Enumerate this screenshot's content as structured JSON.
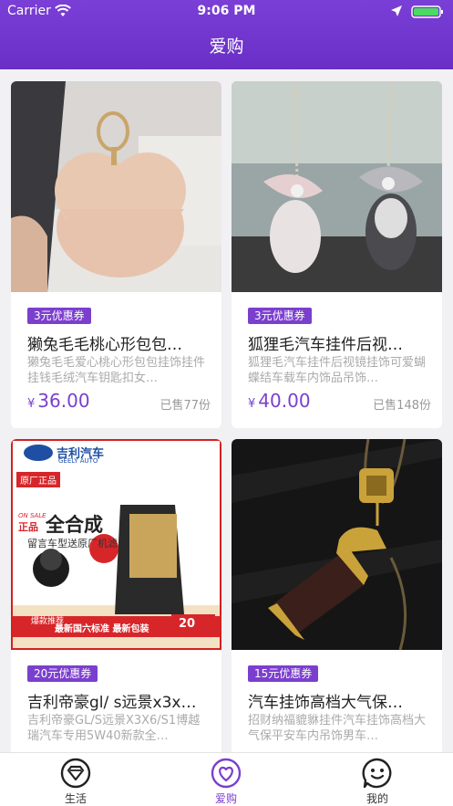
{
  "status_bar": {
    "carrier": "Carrier",
    "time": "9:06 PM"
  },
  "header": {
    "title": "爱购"
  },
  "products": [
    {
      "coupon": "3元优惠券",
      "name": "獭兔毛毛桃心形包包…",
      "desc": "獭兔毛毛爱心桃心形包包挂饰挂件挂钱毛绒汽车钥匙扣女…",
      "currency": "¥",
      "price": "36.00",
      "sold": "已售77份"
    },
    {
      "coupon": "3元优惠券",
      "name": "狐狸毛汽车挂件后视…",
      "desc": "狐狸毛汽车挂件后视镜挂饰可爱蝴蝶结车载车内饰品吊饰…",
      "currency": "¥",
      "price": "40.00",
      "sold": "已售148份"
    },
    {
      "coupon": "20元优惠券",
      "name": "吉利帝豪gl/ s远景x3x…",
      "desc": "吉利帝豪GL/S远景X3X6/S1博越瑞汽车专用5W40新款全…",
      "image_text": {
        "brand": "吉利汽车",
        "brand_en": "GEELY AUTO",
        "genuine": "原厂正品",
        "on_sale": "ON SALE",
        "zhengpin": "正品",
        "quanhecheng": "全合成",
        "gift": "留言车型送原厂机滤",
        "zengpin": "赠品",
        "hot": "爆款推荐",
        "standard": "最新国六标准 最新包装",
        "badge_price": "20"
      }
    },
    {
      "coupon": "15元优惠券",
      "name": "汽车挂饰高档大气保…",
      "desc": "招财纳福貔貅挂件汽车挂饰高档大气保平安车内吊饰男车…"
    }
  ],
  "tabbar": {
    "tabs": [
      {
        "label": "生活",
        "icon": "heart-diamond-icon"
      },
      {
        "label": "爱购",
        "icon": "heart-circle-icon",
        "active": true
      },
      {
        "label": "我的",
        "icon": "smiley-chat-icon"
      }
    ]
  },
  "colors": {
    "accent": "#7b3fce",
    "header": "#6f35cc"
  }
}
